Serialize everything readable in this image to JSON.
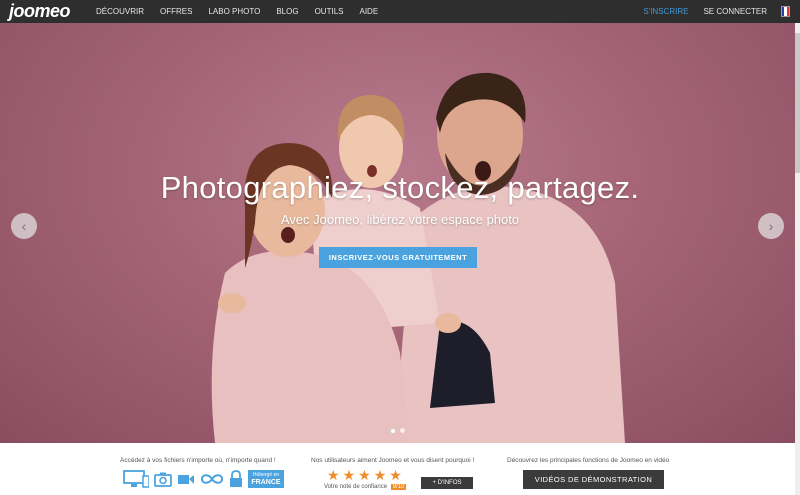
{
  "header": {
    "logo": "joomeo",
    "nav": [
      "DÉCOUVRIR",
      "OFFRES",
      "LABO PHOTO",
      "BLOG",
      "OUTILS",
      "AIDE"
    ],
    "signup": "S'INSCRIRE",
    "login": "SE CONNECTER",
    "flag_colors": [
      "#2340a8",
      "#ffffff",
      "#e03030"
    ]
  },
  "hero": {
    "title": "Photographiez, stockez, partagez.",
    "subtitle": "Avec Joomeo, libérez votre espace photo",
    "cta": "INSCRIVEZ-VOUS GRATUITEMENT",
    "prev_icon": "‹",
    "next_icon": "›",
    "slide_count": 2,
    "active_slide": 1
  },
  "features": {
    "access_caption": "Accédez à vos fichiers n'importe où, n'importe quand !",
    "icons": [
      "desktop-icon",
      "tablet-icon",
      "camera-icon",
      "video-icon",
      "infinity-icon",
      "lock-icon"
    ],
    "badge_top": "Hébergé en",
    "badge_bottom": "FRANCE"
  },
  "trust": {
    "caption": "Nos utilisateurs aiment Joomeo et vous disent pourquoi !",
    "star_count": 5,
    "star_glyph": "★",
    "rating_label": "Votre note de confiance",
    "rating_value": "9/10",
    "more_button": "+ D'INFOS"
  },
  "video": {
    "caption": "Découvrez les principales fonctions de Joomeo en vidéo",
    "button": "VIDÉOS DE DÉMONSTRATION"
  },
  "colors": {
    "accent": "#4aa3df",
    "star": "#f08c2a",
    "topbar": "#2e2e2e"
  }
}
